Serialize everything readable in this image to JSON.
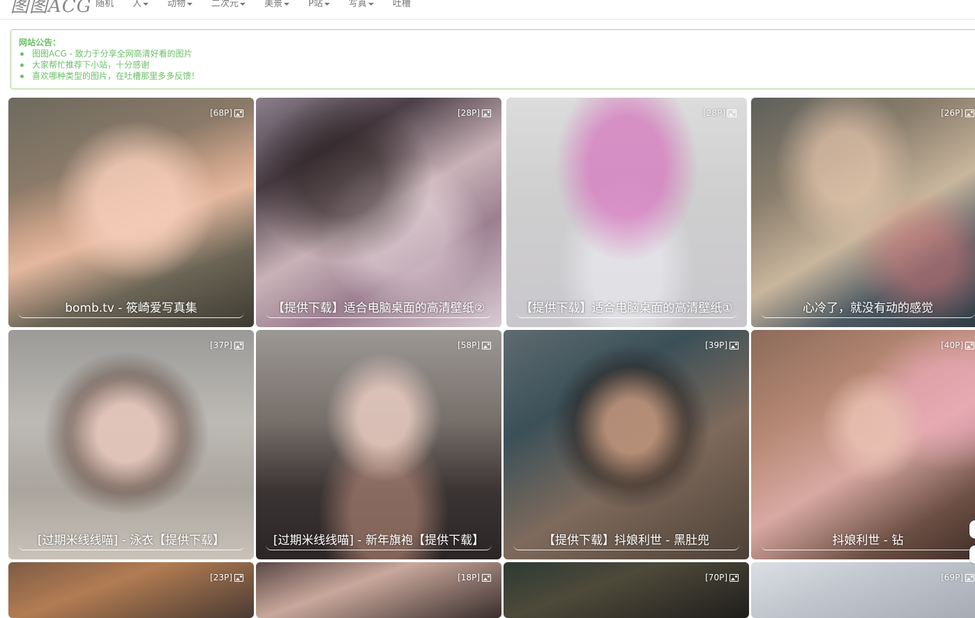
{
  "header": {
    "logo": "图图ACG",
    "nav": [
      {
        "label": "随机",
        "dropdown": false
      },
      {
        "label": "人",
        "dropdown": true
      },
      {
        "label": "动物",
        "dropdown": true
      },
      {
        "label": "二次元",
        "dropdown": true
      },
      {
        "label": "美景",
        "dropdown": true
      },
      {
        "label": "P站",
        "dropdown": true
      },
      {
        "label": "写真",
        "dropdown": true
      },
      {
        "label": "吐槽",
        "dropdown": false
      }
    ]
  },
  "notice": {
    "title": "网站公告：",
    "items": [
      "图图ACG - 致力于分享全网高清好看的图片",
      "大家帮忙推荐下小站，十分感谢",
      "喜欢哪种类型的图片，在吐槽那里多多反馈！"
    ]
  },
  "gallery": [
    {
      "count": "[68P]",
      "title": "bomb.tv - 筱崎爱写真集",
      "icon": "image-icon"
    },
    {
      "count": "[28P]",
      "title": "【提供下载】适合电脑桌面的高清壁纸②",
      "icon": "image-icon"
    },
    {
      "count": "[28P]",
      "title": "【提供下载】适合电脑桌面的高清壁纸①",
      "icon": "image-icon"
    },
    {
      "count": "[26P]",
      "title": "心冷了，就没有动的感觉",
      "icon": "image-icon"
    },
    {
      "count": "[37P]",
      "title": "[过期米线线喵] - 泳衣【提供下载】",
      "icon": "image-icon"
    },
    {
      "count": "[58P]",
      "title": "[过期米线线喵] - 新年旗袍【提供下载】",
      "icon": "image-icon"
    },
    {
      "count": "[39P]",
      "title": "【提供下载】抖娘利世 - 黑肚兜",
      "icon": "image-icon"
    },
    {
      "count": "[40P]",
      "title": "抖娘利世 - 钻",
      "icon": "image-icon"
    },
    {
      "count": "[23P]",
      "title": "",
      "icon": "image-icon"
    },
    {
      "count": "[18P]",
      "title": "",
      "icon": "image-icon"
    },
    {
      "count": "[70P]",
      "title": "",
      "icon": "image-icon"
    },
    {
      "count": "[69P]",
      "title": "",
      "icon": "image-icon"
    }
  ]
}
